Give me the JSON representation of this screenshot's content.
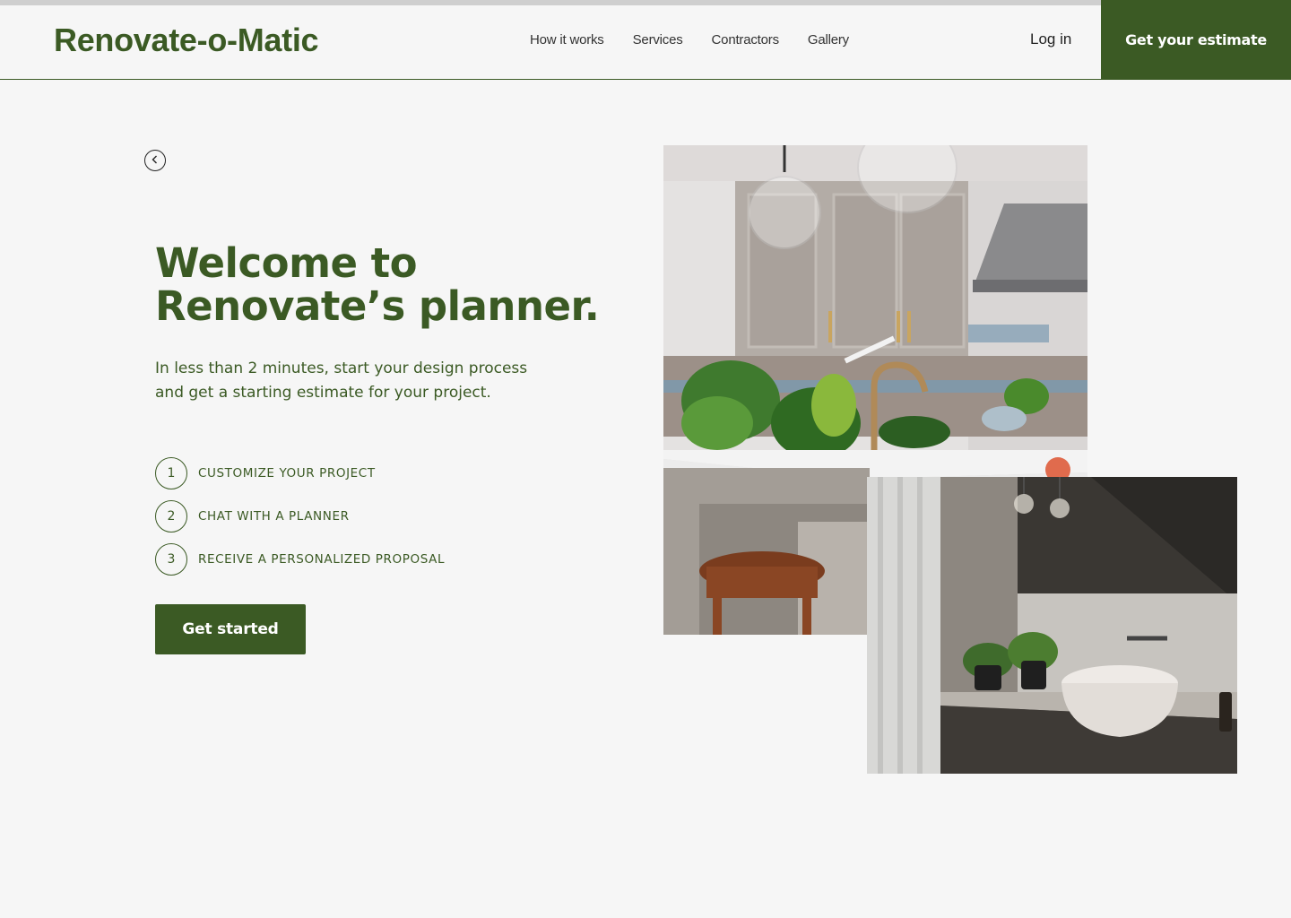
{
  "header": {
    "logo": "Renovate-o-Matic",
    "nav": [
      "How it works",
      "Services",
      "Contractors",
      "Gallery"
    ],
    "login_label": "Log in",
    "cta_label": "Get your estimate"
  },
  "hero": {
    "title_line1": "Welcome to",
    "title_line2": "Renovate’s planner.",
    "subtitle": "In less than 2 minutes, start your design process and get a starting estimate for your project.",
    "steps": [
      {
        "num": "1",
        "label": "CUSTOMIZE YOUR PROJECT"
      },
      {
        "num": "2",
        "label": "CHAT WITH A PLANNER"
      },
      {
        "num": "3",
        "label": "RECEIVE A PERSONALIZED PROPOSAL"
      }
    ],
    "button_label": "Get started"
  },
  "icons": {
    "back": "chevron-left-circle-icon"
  },
  "colors": {
    "brand": "#3b5a24",
    "background": "#f6f6f6"
  }
}
